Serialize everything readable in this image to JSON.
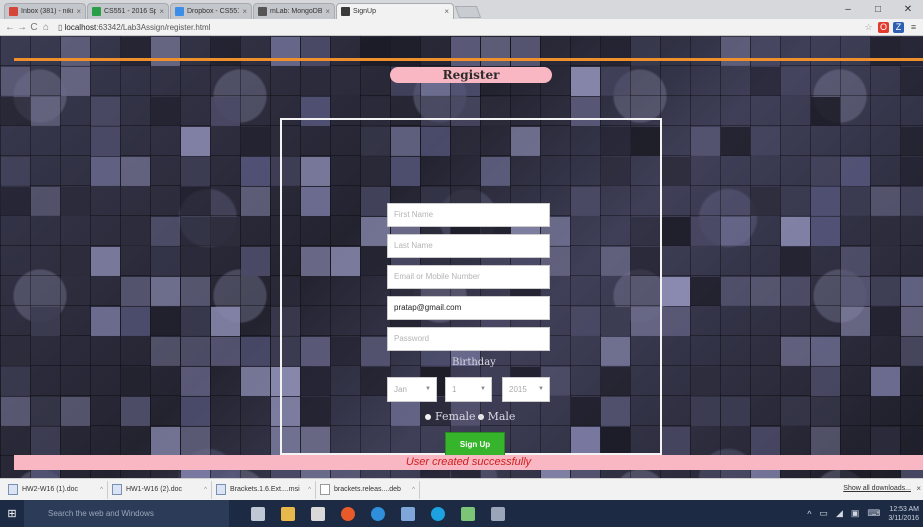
{
  "browser": {
    "tabs": [
      {
        "title": "Inbox (381) - nikithi",
        "favicon_color": "#d44638"
      },
      {
        "title": "CS551 - 2016 Sprin",
        "favicon_color": "#2a9d47"
      },
      {
        "title": "Dropbox - CS551_T",
        "favicon_color": "#3d8ee8"
      },
      {
        "title": "mLab: MongoDB-as",
        "favicon_color": "#555555"
      },
      {
        "title": "SignUp",
        "favicon_color": "#3a3a3a",
        "active": true
      }
    ],
    "window_controls": [
      "–",
      "□",
      "✕"
    ],
    "url_host": "localhost",
    "url_rest": ":63342/Lab3Assign/register.html"
  },
  "page": {
    "header": "Register",
    "form": {
      "first_name_placeholder": "First Name",
      "last_name_placeholder": "Last Name",
      "email_placeholder": "Email or Mobile Number",
      "email_value": "pratap@gmail.com",
      "password_placeholder": "Password",
      "birthday_label": "Birthday",
      "month": "Jan",
      "day": "1",
      "year": "2015",
      "gender_female": "Female",
      "gender_male": "Male",
      "submit_label": "Sign Up"
    },
    "status_message": "User created successfully"
  },
  "downloads": {
    "items": [
      "HW2-W16 (1).doc",
      "HW1-W16 (2).doc",
      "Brackets.1.6.Ext....msi",
      "brackets.releas....deb"
    ],
    "show_all": "Show all downloads..."
  },
  "taskbar": {
    "search_placeholder": "Search the web and Windows",
    "time": "12:53 AM",
    "date": "3/11/2016",
    "app_icon_colors": [
      "#bfc7d5",
      "#e8b94a",
      "#d9d9d9",
      "#e85a2a",
      "#2f8fdb",
      "#7ea6d8",
      "#1da1e0",
      "#7cc576",
      "#9aa5b9"
    ]
  },
  "colors": {
    "accent_line": "#f0902c",
    "header_bg": "#f8b7c2",
    "signup_bg": "#36b52c",
    "success_text": "#d11c1c"
  }
}
